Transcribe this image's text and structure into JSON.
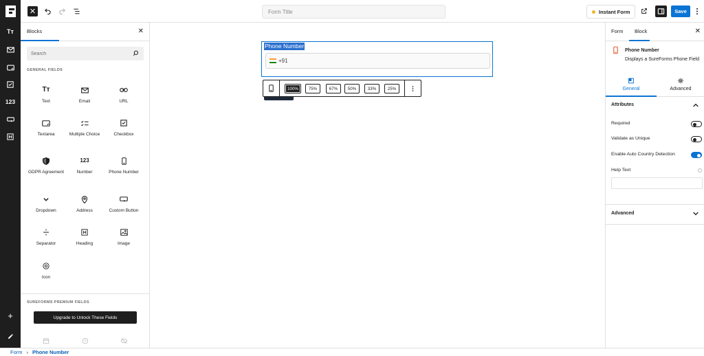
{
  "header": {
    "form_title_placeholder": "Form Title",
    "instant_form_label": "Instant Form",
    "save_label": "Save"
  },
  "inserter": {
    "tab_label": "Blocks",
    "search_placeholder": "Search",
    "general_fields_label": "GENERAL FIELDS",
    "blocks": [
      {
        "label": "Text",
        "icon": "text-format-icon"
      },
      {
        "label": "Email",
        "icon": "envelope-icon"
      },
      {
        "label": "URL",
        "icon": "link-icon"
      },
      {
        "label": "Textarea",
        "icon": "textarea-icon"
      },
      {
        "label": "Multiple Choice",
        "icon": "checklist-icon"
      },
      {
        "label": "Checkbox",
        "icon": "checkbox-icon"
      },
      {
        "label": "GDPR Agreement",
        "icon": "shield-icon"
      },
      {
        "label": "Number",
        "icon": "number-icon"
      },
      {
        "label": "Phone Number",
        "icon": "mobile-phone-icon"
      },
      {
        "label": "Dropdown",
        "icon": "chevron-down-icon"
      },
      {
        "label": "Address",
        "icon": "map-pin-icon"
      },
      {
        "label": "Custom Button",
        "icon": "button-icon"
      },
      {
        "label": "Separator",
        "icon": "separator-icon"
      },
      {
        "label": "Heading",
        "icon": "heading-icon"
      },
      {
        "label": "Image",
        "icon": "image-icon"
      },
      {
        "label": "Icon",
        "icon": "smiley-icon"
      }
    ],
    "premium_fields_label": "SUREFORMS PREMIUM FIELDS",
    "upgrade_label": "Upgrade to Unlock These Fields"
  },
  "left_toolbar": {
    "number_icon_text": "123"
  },
  "canvas": {
    "field_label": "Phone Number",
    "country_code": "+91",
    "width_options": [
      "100%",
      "75%",
      "67%",
      "50%",
      "33%",
      "25%"
    ],
    "active_width": "100%"
  },
  "settings": {
    "tab_form": "Form",
    "tab_block": "Block",
    "block_name": "Phone Number",
    "block_description": "Displays a SureForms Phone Field",
    "tab_general": "General",
    "tab_advanced": "Advanced",
    "attributes_label": "Attributes",
    "toggles": [
      {
        "label": "Required",
        "on": false
      },
      {
        "label": "Validate as Unique",
        "on": false
      },
      {
        "label": "Enable Auto Country Detection",
        "on": true
      }
    ],
    "help_text_label": "Help Text",
    "advanced_label": "Advanced"
  },
  "breadcrumb": {
    "root": "Form",
    "current": "Phone Number"
  },
  "colors": {
    "accent": "#0a74d4",
    "dark": "#1e1e1e"
  }
}
